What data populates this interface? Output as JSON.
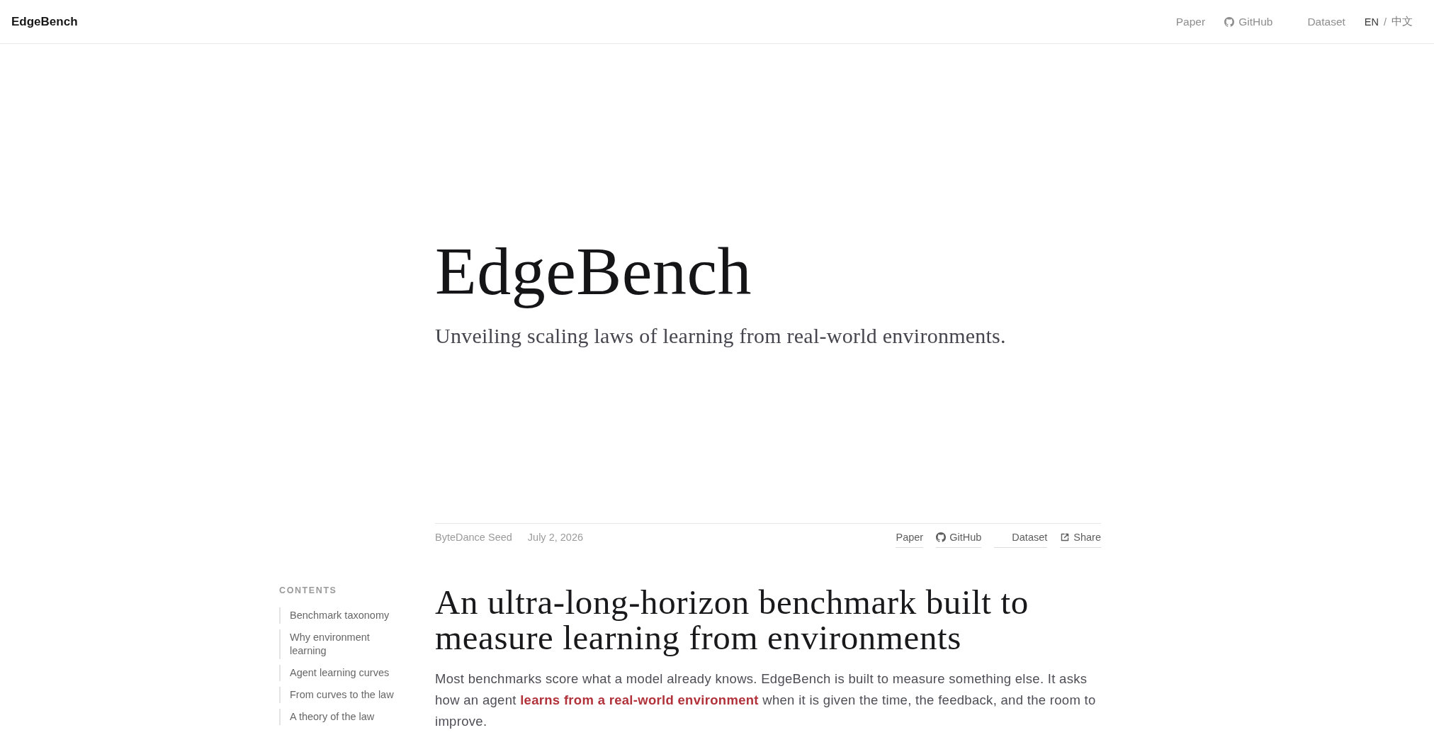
{
  "nav": {
    "logo": "EdgeBench",
    "links": [
      {
        "label": "Paper",
        "kind": "plain"
      },
      {
        "label": "GitHub",
        "kind": "github"
      },
      {
        "label": "Dataset",
        "kind": "gapped"
      }
    ],
    "languages": [
      {
        "label": "EN",
        "selected": true
      },
      {
        "label": "中文",
        "selected": false
      }
    ],
    "separator": "/"
  },
  "hero": {
    "title": "EdgeBench",
    "subtitle": "Unveiling scaling laws of learning from real-world environments."
  },
  "byline": {
    "author": "ByteDance Seed",
    "date": "July 2, 2026",
    "links": [
      {
        "label": "Paper",
        "kind": "plain"
      },
      {
        "label": "GitHub",
        "kind": "github"
      },
      {
        "label": "Dataset",
        "kind": "gapped"
      },
      {
        "label": "Share",
        "kind": "share"
      }
    ]
  },
  "contents": {
    "label": "CONTENTS",
    "items": [
      "Benchmark taxonomy",
      "Why environment learning",
      "Agent learning curves",
      "From curves to the law",
      "A theory of the law"
    ]
  },
  "article": {
    "heading": "An ultra-long-horizon benchmark built to measure learning from environments",
    "paragraph": "Most benchmarks score what a model already knows. EdgeBench is built to measure something else. It asks how an agent **learns from a real-world environment** when it is given the time, the feedback, and the room to improve."
  }
}
